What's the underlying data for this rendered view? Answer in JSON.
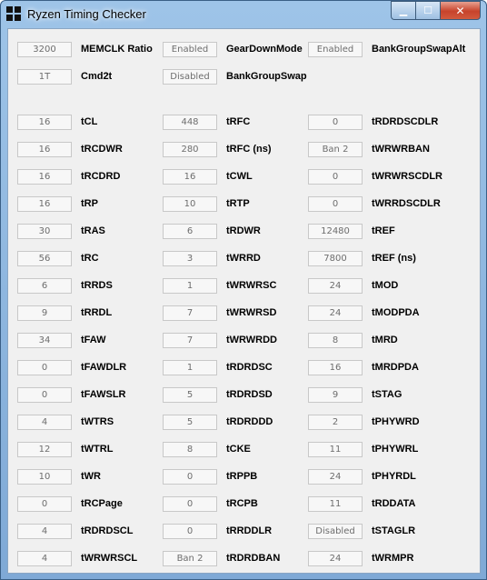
{
  "window": {
    "title": "Ryzen Timing Checker"
  },
  "controls": {
    "minimize": "▁",
    "maximize": "☐",
    "close": "✕"
  },
  "header_rows": [
    [
      {
        "value": "3200",
        "label": "MEMCLK Ratio"
      },
      {
        "value": "Enabled",
        "label": "GearDownMode"
      },
      {
        "value": "Enabled",
        "label": "BankGroupSwapAlt"
      }
    ],
    [
      {
        "value": "1T",
        "label": "Cmd2t"
      },
      {
        "value": "Disabled",
        "label": "BankGroupSwap"
      }
    ]
  ],
  "timing_rows": [
    [
      {
        "value": "16",
        "label": "tCL"
      },
      {
        "value": "448",
        "label": "tRFC"
      },
      {
        "value": "0",
        "label": "tRDRDSCDLR"
      }
    ],
    [
      {
        "value": "16",
        "label": "tRCDWR"
      },
      {
        "value": "280",
        "label": "tRFC (ns)"
      },
      {
        "value": "Ban 2",
        "label": "tWRWRBAN"
      }
    ],
    [
      {
        "value": "16",
        "label": "tRCDRD"
      },
      {
        "value": "16",
        "label": "tCWL"
      },
      {
        "value": "0",
        "label": "tWRWRSCDLR"
      }
    ],
    [
      {
        "value": "16",
        "label": "tRP"
      },
      {
        "value": "10",
        "label": "tRTP"
      },
      {
        "value": "0",
        "label": "tWRRDSCDLR"
      }
    ],
    [
      {
        "value": "30",
        "label": "tRAS"
      },
      {
        "value": "6",
        "label": "tRDWR"
      },
      {
        "value": "12480",
        "label": "tREF"
      }
    ],
    [
      {
        "value": "56",
        "label": "tRC"
      },
      {
        "value": "3",
        "label": "tWRRD"
      },
      {
        "value": "7800",
        "label": "tREF (ns)"
      }
    ],
    [
      {
        "value": "6",
        "label": "tRRDS"
      },
      {
        "value": "1",
        "label": "tWRWRSC"
      },
      {
        "value": "24",
        "label": "tMOD"
      }
    ],
    [
      {
        "value": "9",
        "label": "tRRDL"
      },
      {
        "value": "7",
        "label": "tWRWRSD"
      },
      {
        "value": "24",
        "label": "tMODPDA"
      }
    ],
    [
      {
        "value": "34",
        "label": "tFAW"
      },
      {
        "value": "7",
        "label": "tWRWRDD"
      },
      {
        "value": "8",
        "label": "tMRD"
      }
    ],
    [
      {
        "value": "0",
        "label": "tFAWDLR"
      },
      {
        "value": "1",
        "label": "tRDRDSC"
      },
      {
        "value": "16",
        "label": "tMRDPDA"
      }
    ],
    [
      {
        "value": "0",
        "label": "tFAWSLR"
      },
      {
        "value": "5",
        "label": "tRDRDSD"
      },
      {
        "value": "9",
        "label": "tSTAG"
      }
    ],
    [
      {
        "value": "4",
        "label": "tWTRS"
      },
      {
        "value": "5",
        "label": "tRDRDDD"
      },
      {
        "value": "2",
        "label": "tPHYWRD"
      }
    ],
    [
      {
        "value": "12",
        "label": "tWTRL"
      },
      {
        "value": "8",
        "label": "tCKE"
      },
      {
        "value": "11",
        "label": "tPHYWRL"
      }
    ],
    [
      {
        "value": "10",
        "label": "tWR"
      },
      {
        "value": "0",
        "label": "tRPPB"
      },
      {
        "value": "24",
        "label": "tPHYRDL"
      }
    ],
    [
      {
        "value": "0",
        "label": "tRCPage"
      },
      {
        "value": "0",
        "label": "tRCPB"
      },
      {
        "value": "11",
        "label": "tRDDATA"
      }
    ],
    [
      {
        "value": "4",
        "label": "tRDRDSCL"
      },
      {
        "value": "0",
        "label": "tRRDDLR"
      },
      {
        "value": "Disabled",
        "label": "tSTAGLR"
      }
    ],
    [
      {
        "value": "4",
        "label": "tWRWRSCL"
      },
      {
        "value": "Ban 2",
        "label": "tRDRDBAN"
      },
      {
        "value": "24",
        "label": "tWRMPR"
      }
    ]
  ]
}
